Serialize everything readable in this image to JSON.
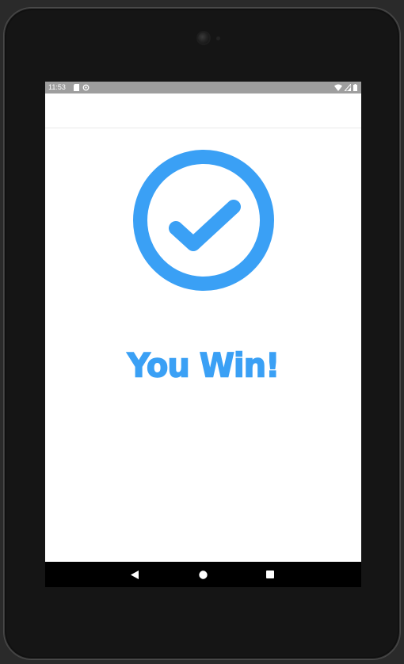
{
  "status_bar": {
    "time": "11:53",
    "icons": [
      "sd-card-icon",
      "sync-icon",
      "wifi-icon",
      "signal-icon",
      "battery-icon"
    ]
  },
  "main": {
    "icon": "check-circle-icon",
    "message": "You Win!",
    "accent_color": "#3aa0f5"
  },
  "nav_bar": {
    "buttons": [
      "back-icon",
      "home-icon",
      "recents-icon"
    ]
  }
}
